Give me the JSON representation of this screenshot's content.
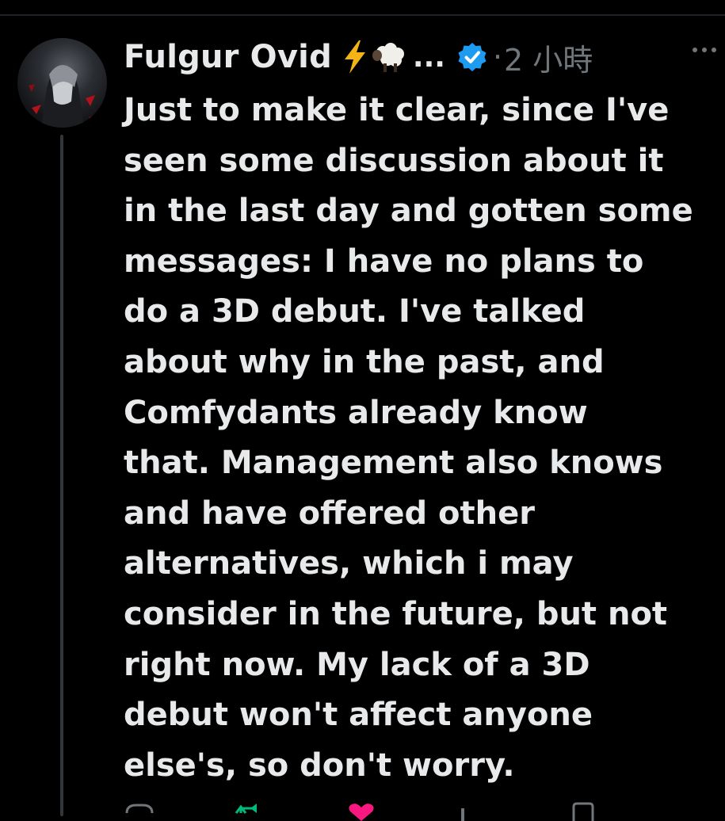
{
  "post": {
    "author": {
      "display_name": "Fulgur Ovid",
      "badges": [
        "bolt-emoji",
        "sheep-emoji"
      ],
      "truncation": "...",
      "verified": true,
      "avatar_icon": "avatar"
    },
    "separator": "·",
    "timestamp": "2 小時",
    "more_icon": "more-horizontal-icon",
    "text_lines": [
      "Just to make it clear, since I've",
      "seen some discussion about it",
      "in the last day and gotten some",
      "messages: I have no plans to",
      "do a 3D debut. I've talked",
      "about why in the past, and",
      "Comfydants already know",
      "that. Management also knows",
      "and have offered other",
      "alternatives, which i may",
      "consider in the future, but not",
      "right now. My lack of a 3D",
      "debut won't affect anyone",
      "else's, so don't worry."
    ],
    "actions": [
      {
        "icon": "reply-icon",
        "color": "#71767b"
      },
      {
        "icon": "repost-icon",
        "color": "#00ba7c"
      },
      {
        "icon": "like-icon",
        "color": "#f91880"
      },
      {
        "icon": "views-icon",
        "color": "#71767b"
      },
      {
        "icon": "bookmark-icon",
        "color": "#71767b"
      }
    ]
  },
  "colors": {
    "background": "#000000",
    "text": "#e7e9ea",
    "muted": "#71767b",
    "verified": "#1d9bf0",
    "thread_line": "#333639"
  }
}
